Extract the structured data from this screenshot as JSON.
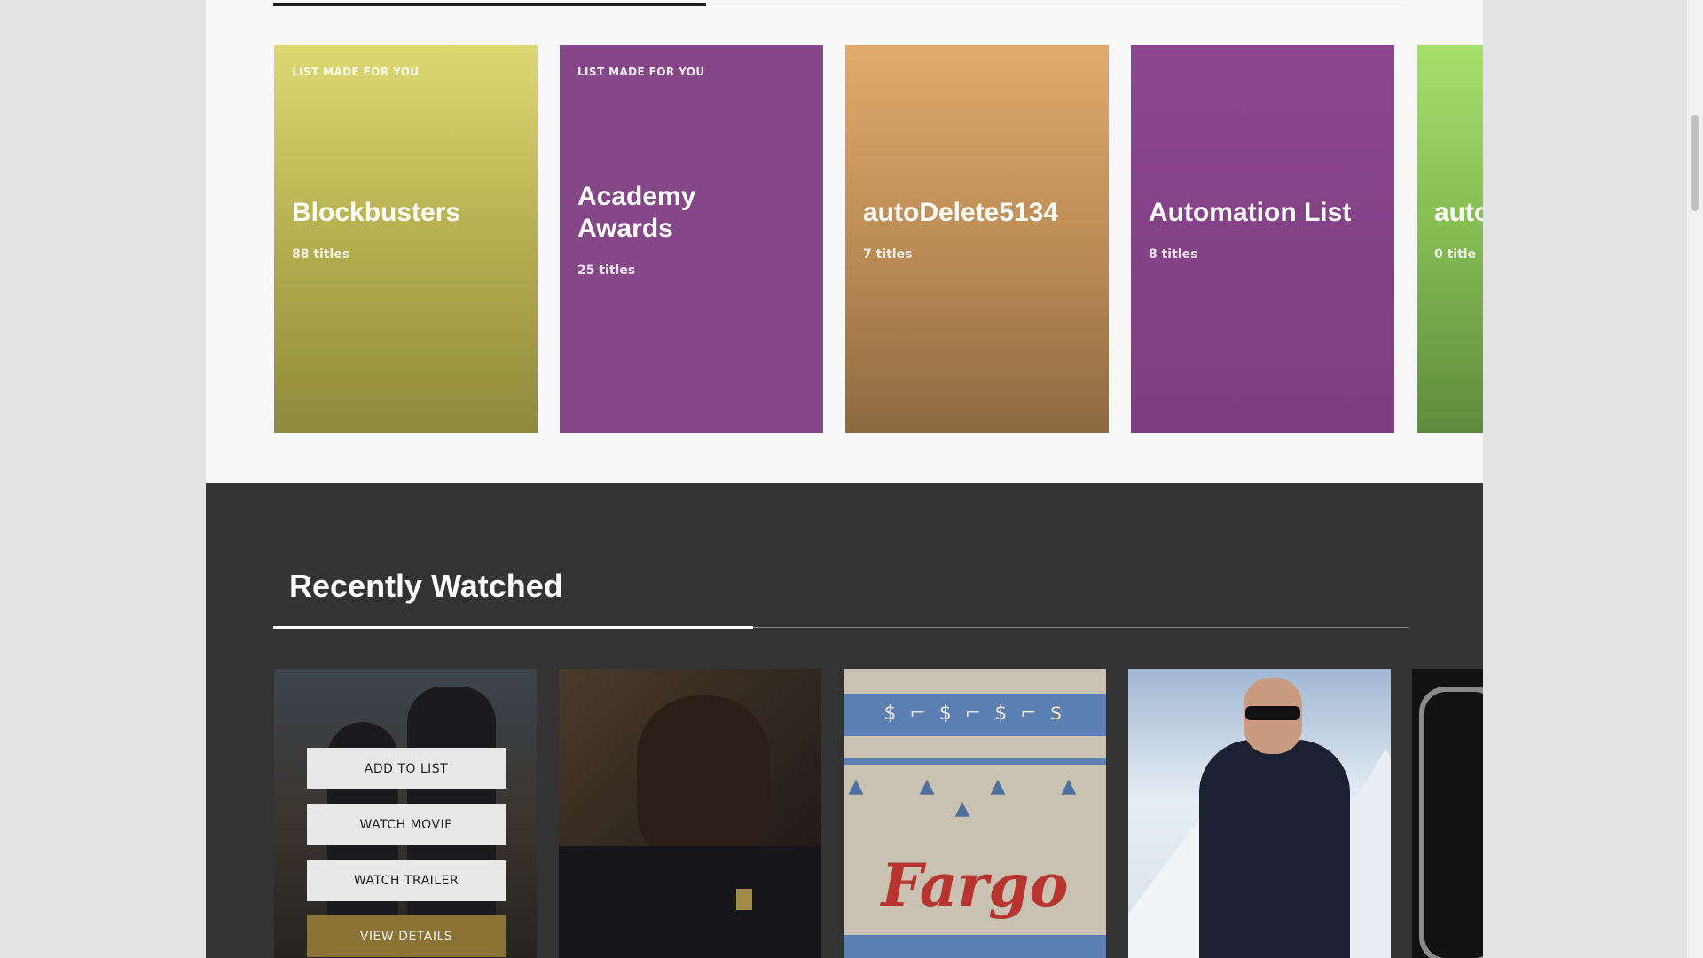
{
  "lists": [
    {
      "tag": "LIST MADE FOR YOU",
      "title": "Blockbusters",
      "count": "88 titles"
    },
    {
      "tag": "LIST MADE FOR YOU",
      "title": "Academy Awards",
      "count": "25 titles"
    },
    {
      "tag": "",
      "title": "autoDelete5134",
      "count": "7 titles"
    },
    {
      "tag": "",
      "title": "Automation List",
      "count": "8 titles"
    },
    {
      "tag": "",
      "title": "auto",
      "count": "0 title"
    }
  ],
  "recently_watched": {
    "heading": "Recently Watched",
    "actions": {
      "add_to_list": "ADD TO LIST",
      "watch_movie": "WATCH MOVIE",
      "watch_trailer": "WATCH TRAILER",
      "view_details": "VIEW DETAILS"
    },
    "fargo_logo": "Fargo",
    "pattern_row": "$ ⌐ $ ⌐ $ ⌐ $",
    "deer_row": "$ ♆ $ ♆ $",
    "trees_row": "▲ ▲ ▲ ▲ ▲"
  },
  "colors": {
    "page_bg": "#f8f8f8",
    "dark_bg": "#333333",
    "gold_button": "#8a7334"
  }
}
